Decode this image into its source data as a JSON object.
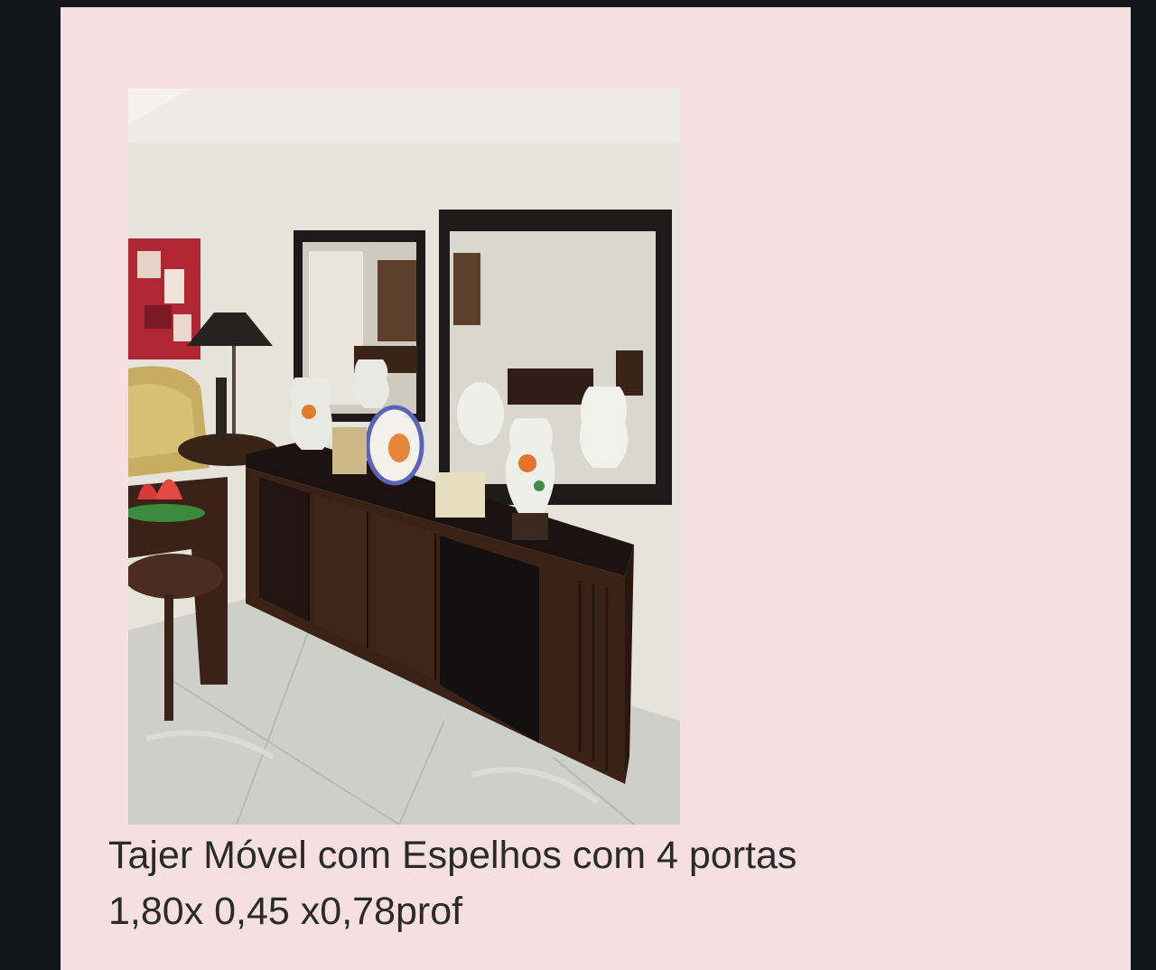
{
  "post": {
    "title": "Tajer Móvel com Espelhos com 4 portas",
    "dimensions": "1,80x 0,45 x0,78prof"
  },
  "colors": {
    "background": "#121519",
    "card": "#f5dfe0",
    "text": "#2a2a2a"
  }
}
